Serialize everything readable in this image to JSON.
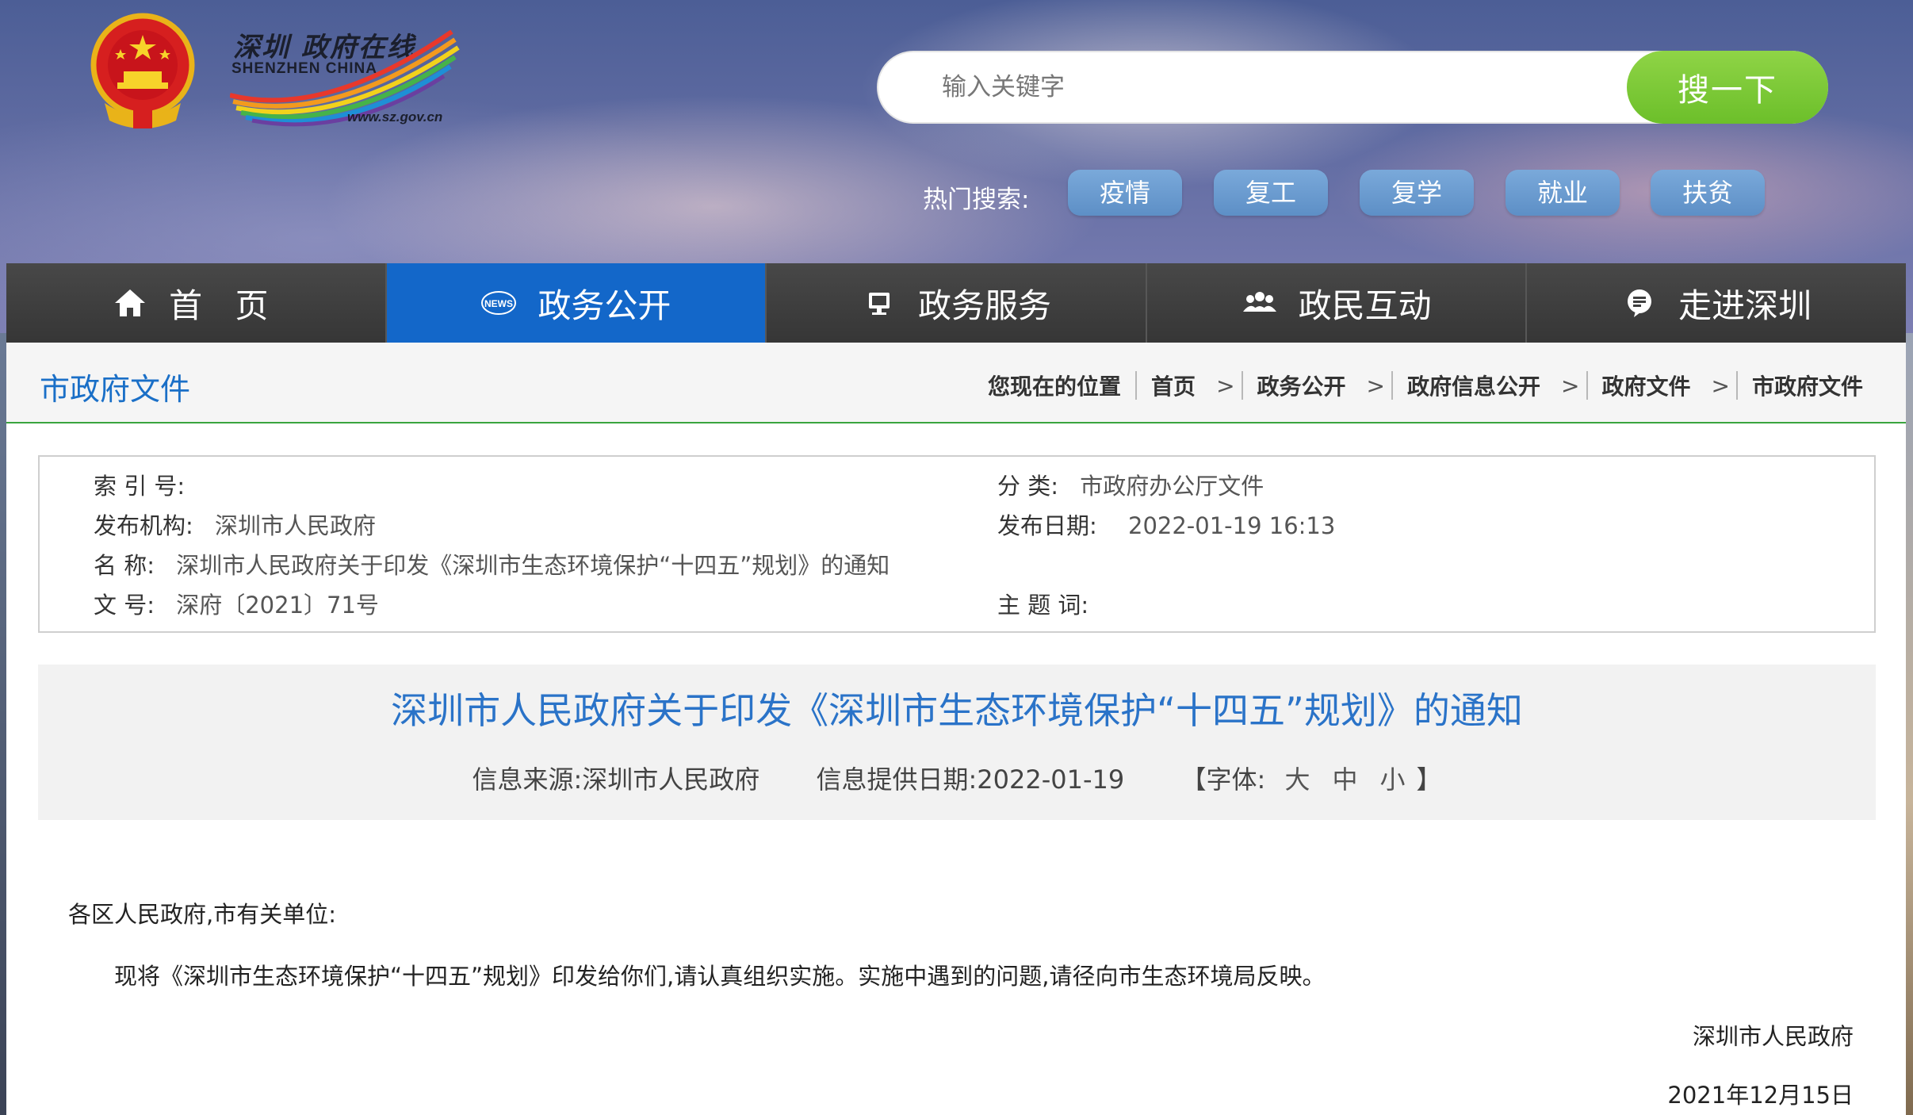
{
  "header": {
    "logo_cn": "深圳 政府在线",
    "logo_en": "SHENZHEN CHINA",
    "logo_url": "www.sz.gov.cn"
  },
  "search": {
    "placeholder": "输入关键字",
    "button_label": "搜一下",
    "hot_label": "热门搜索:",
    "hot_tags": [
      "疫情",
      "复工",
      "复学",
      "就业",
      "扶贫"
    ]
  },
  "nav": {
    "items": [
      {
        "label": "首 页",
        "icon": "home-icon"
      },
      {
        "label": "政务公开",
        "icon": "news-icon"
      },
      {
        "label": "政务服务",
        "icon": "monitor-icon"
      },
      {
        "label": "政民互动",
        "icon": "people-icon"
      },
      {
        "label": "走进深圳",
        "icon": "info-icon"
      }
    ],
    "active_index": 1
  },
  "breadcrumb": {
    "section_title": "市政府文件",
    "location_label": "您现在的位置",
    "items": [
      "首页",
      "政务公开",
      "政府信息公开",
      "政府文件",
      "市政府文件"
    ]
  },
  "meta": {
    "index_label": "索 引 号:",
    "index_value": "",
    "category_label": "分 类:",
    "category_value": "市政府办公厅文件",
    "publisher_label": "发布机构:",
    "publisher_value": "深圳市人民政府",
    "date_label": "发布日期:",
    "date_value": "2022-01-19 16:13",
    "name_label": "名 称:",
    "name_value": "深圳市人民政府关于印发《深圳市生态环境保护“十四五”规划》的通知",
    "doc_no_label": "文 号:",
    "doc_no_value": "深府〔2021〕71号",
    "keywords_label": "主 题 词:",
    "keywords_value": ""
  },
  "article": {
    "title": "深圳市人民政府关于印发《深圳市生态环境保护“十四五”规划》的通知",
    "source": "信息来源:深圳市人民政府",
    "provide_date": "信息提供日期:2022-01-19",
    "font_label": "【字体:",
    "font_large": "大",
    "font_medium": "中",
    "font_small": "小",
    "font_close": "】",
    "salutation": "各区人民政府,市有关单位:",
    "paragraph": "现将《深圳市生态环境保护“十四五”规划》印发给你们,请认真组织实施。实施中遇到的问题,请径向市生态环境局反映。",
    "signature": "深圳市人民政府",
    "sign_date": "2021年12月15日"
  },
  "colors": {
    "nav_active": "#1367c9",
    "search_button": "#7ac936",
    "hot_tag": "#6b9ed1",
    "title_blue": "#2a73c8",
    "divider_green": "#3aa43f"
  }
}
